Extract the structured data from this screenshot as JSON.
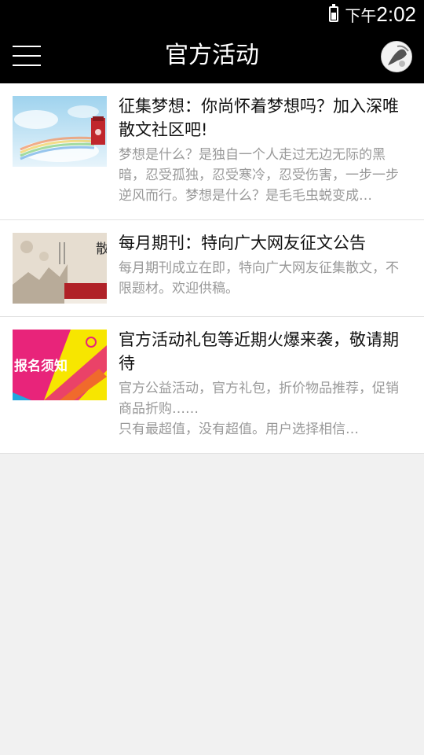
{
  "status_bar": {
    "period": "下午",
    "time": "2:02"
  },
  "app_bar": {
    "title": "官方活动"
  },
  "articles": [
    {
      "title": "征集梦想：你尚怀着梦想吗？加入深唯散文社区吧!",
      "summary": "梦想是什么？是独自一个人走过无边无际的黑暗，忍受孤独，忍受寒冷，忍受伤害，一步一步逆风而行。梦想是什么？是毛毛虫蜕变成…",
      "thumb_icon": "dream-poster-thumbnail"
    },
    {
      "title": "每月期刊：特向广大网友征文公告",
      "summary": "每月期刊成立在即，特向广大网友征集散文，不限题材。欢迎供稿。",
      "thumb_icon": "essay-collection-thumbnail",
      "thumb_text": "散文集"
    },
    {
      "title": "官方活动礼包等近期火爆来袭，敬请期待",
      "summary": "官方公益活动，官方礼包，折价物品推荐，促销商品折购……\n只有最超值，没有超值。用户选择相信…",
      "thumb_icon": "signup-notice-thumbnail",
      "thumb_text": "报名须知"
    }
  ]
}
